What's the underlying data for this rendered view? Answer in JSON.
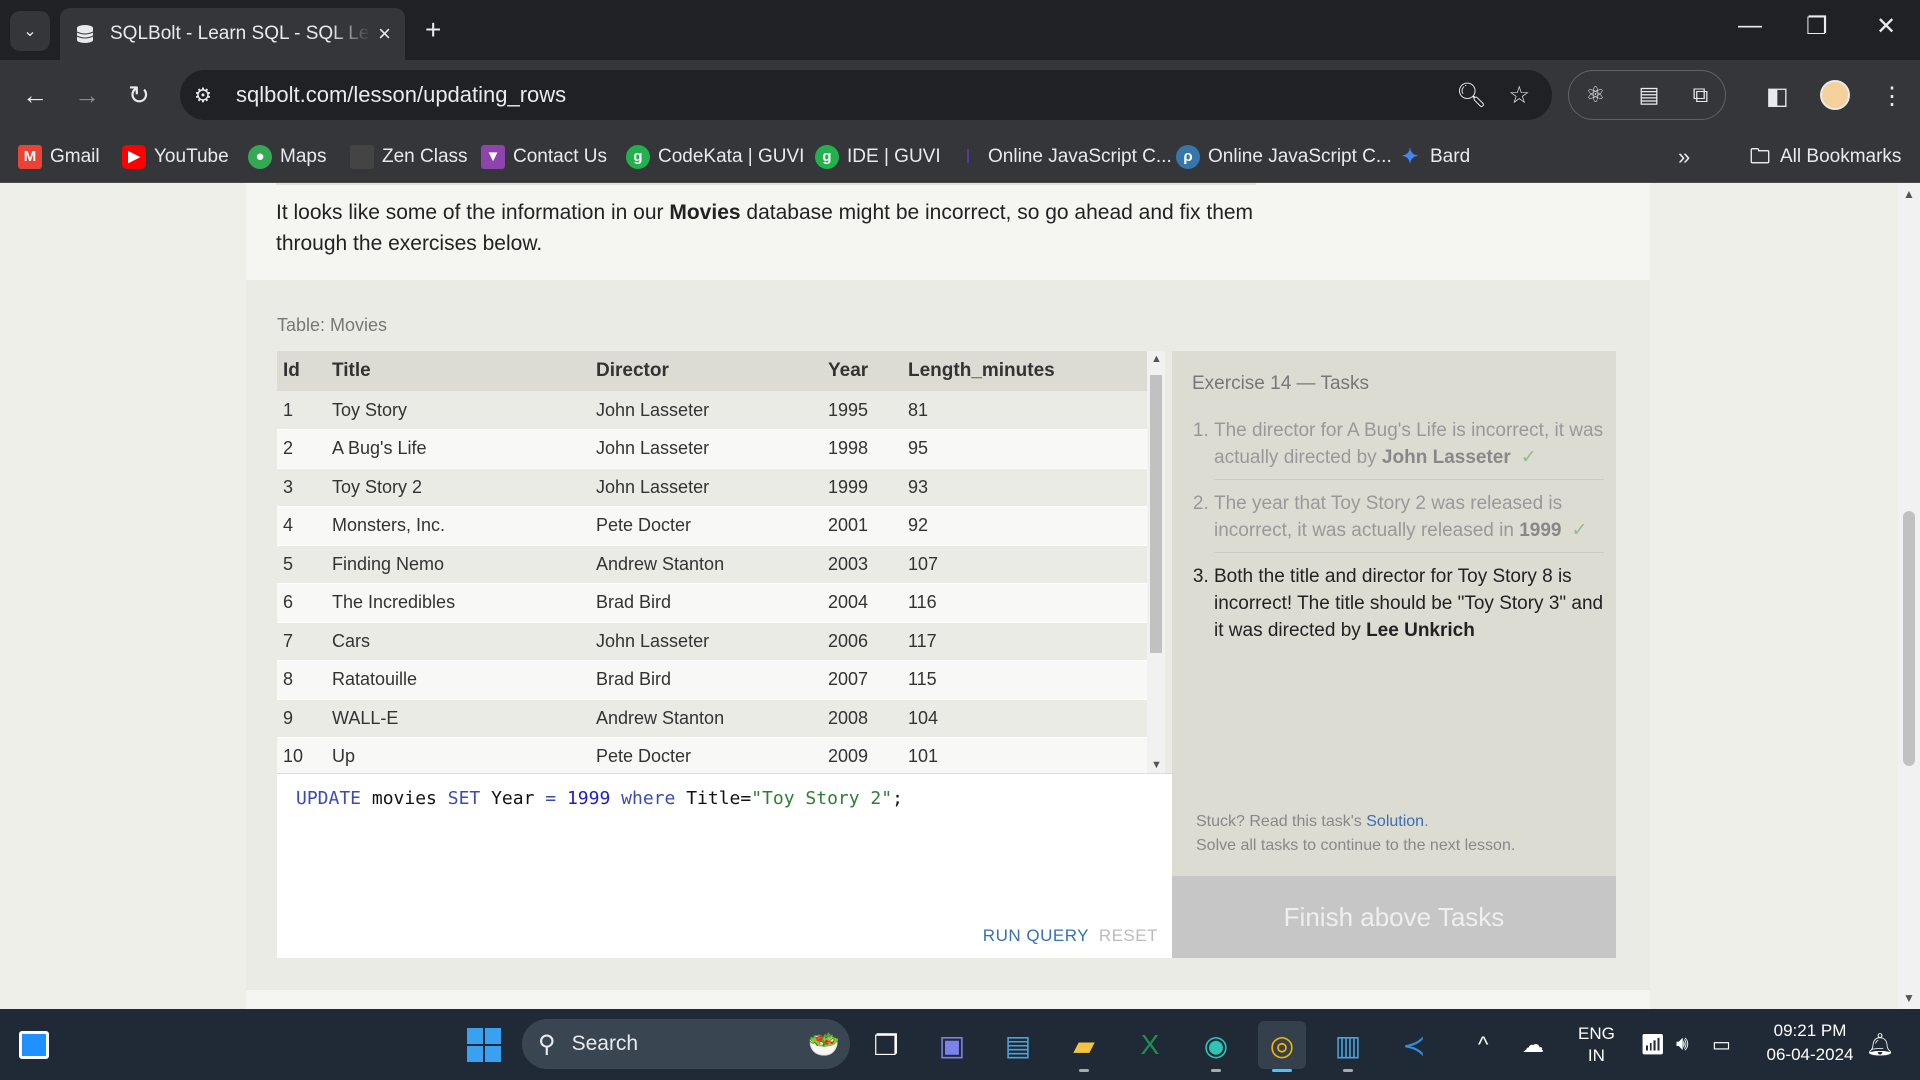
{
  "browser": {
    "tab_title": "SQLBolt - Learn SQL - SQL Lesson",
    "url": "sqlbolt.com/lesson/updating_rows",
    "window_controls": [
      "minimize-icon",
      "restore-icon",
      "close-icon"
    ]
  },
  "bookmarks": [
    {
      "label": "Gmail",
      "icon": "gmail-icon",
      "color": "#ea4335"
    },
    {
      "label": "YouTube",
      "icon": "youtube-icon",
      "color": "#ff0000"
    },
    {
      "label": "Maps",
      "icon": "maps-icon",
      "color": "#34a853"
    },
    {
      "label": "Zen Class",
      "icon": "zen-class-icon",
      "color": "#444444"
    },
    {
      "label": "Contact Us",
      "icon": "contact-us-icon",
      "color": "#8e44ad"
    },
    {
      "label": "CodeKata | GUVI",
      "icon": "guvi-icon",
      "color": "#22b14c"
    },
    {
      "label": "IDE | GUVI",
      "icon": "guvi-icon",
      "color": "#22b14c"
    },
    {
      "label": "Online JavaScript C...",
      "icon": "js-compiler-icon",
      "color": "#6a3de8"
    },
    {
      "label": "Online JavaScript C...",
      "icon": "python-icon",
      "color": "#3776ab"
    },
    {
      "label": "Bard",
      "icon": "bard-icon",
      "color": "#4285f4"
    }
  ],
  "all_bookmarks_label": "All Bookmarks",
  "lesson": {
    "intro_part1": "It looks like some of the information in our ",
    "intro_bold": "Movies",
    "intro_part2": " database might be incorrect, so go ahead and fix them through the exercises below.",
    "table_label": "Table: Movies",
    "columns": [
      "Id",
      "Title",
      "Director",
      "Year",
      "Length_minutes"
    ],
    "rows": [
      [
        "1",
        "Toy Story",
        "John Lasseter",
        "1995",
        "81"
      ],
      [
        "2",
        "A Bug's Life",
        "John Lasseter",
        "1998",
        "95"
      ],
      [
        "3",
        "Toy Story 2",
        "John Lasseter",
        "1999",
        "93"
      ],
      [
        "4",
        "Monsters, Inc.",
        "Pete Docter",
        "2001",
        "92"
      ],
      [
        "5",
        "Finding Nemo",
        "Andrew Stanton",
        "2003",
        "107"
      ],
      [
        "6",
        "The Incredibles",
        "Brad Bird",
        "2004",
        "116"
      ],
      [
        "7",
        "Cars",
        "John Lasseter",
        "2006",
        "117"
      ],
      [
        "8",
        "Ratatouille",
        "Brad Bird",
        "2007",
        "115"
      ],
      [
        "9",
        "WALL-E",
        "Andrew Stanton",
        "2008",
        "104"
      ],
      [
        "10",
        "Up",
        "Pete Docter",
        "2009",
        "101"
      ]
    ],
    "query": {
      "kw1": "UPDATE",
      "t1": " movies ",
      "kw2": "SET",
      "t2": " Year ",
      "op": "=",
      "t3": " ",
      "num": "1999",
      "t4": " ",
      "kw3": "where",
      "t5": " Title=",
      "str": "\"Toy Story 2\"",
      "t6": ";"
    },
    "run_label": "RUN QUERY",
    "reset_label": "RESET",
    "tasks_title": "Exercise 14 — Tasks",
    "tasks": [
      {
        "text": "The director for A Bug's Life is incorrect, it was actually directed by ",
        "bold": "John Lasseter",
        "done": true
      },
      {
        "text": "The year that Toy Story 2 was released is incorrect, it was actually released in ",
        "bold": "1999",
        "done": true
      },
      {
        "text": "Both the title and director for Toy Story 8 is incorrect! The title should be \"Toy Story 3\" and it was directed by ",
        "bold": "Lee Unkrich",
        "done": false
      }
    ],
    "stuck_prefix": "Stuck? Read this task's ",
    "solution_link": "Solution",
    "stuck_suffix": ".",
    "solve_all": "Solve all tasks to continue to the next lesson.",
    "finish_label": "Finish above Tasks"
  },
  "taskbar": {
    "search_placeholder": "Search",
    "lang": "ENG",
    "region": "IN",
    "time": "09:21 PM",
    "date": "06-04-2024"
  }
}
